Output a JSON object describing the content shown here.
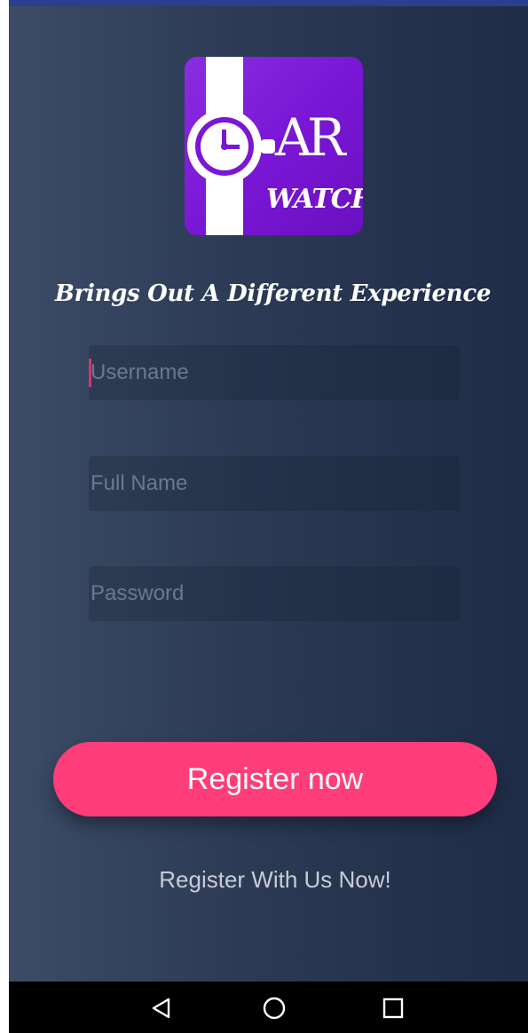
{
  "app": {
    "logo": {
      "text_ar": "AR",
      "text_watch": "WATCH",
      "icon": "watch-icon",
      "colors": {
        "background": "#7a17d6",
        "foreground": "#ffffff"
      }
    },
    "tagline": "Brings Out A Different Experience"
  },
  "form": {
    "username": {
      "placeholder": "Username",
      "value": ""
    },
    "fullname": {
      "placeholder": "Full Name",
      "value": ""
    },
    "password": {
      "placeholder": "Password",
      "value": ""
    }
  },
  "actions": {
    "register_button": "Register now",
    "register_link": "Register With Us Now!"
  },
  "navigation": {
    "back_icon": "back-triangle-icon",
    "home_icon": "home-circle-icon",
    "recents_icon": "recents-square-icon"
  },
  "colors": {
    "accent": "#ff3d7a",
    "background_light": "#3c4c66",
    "background_dark": "#1f2c47",
    "cursor": "#d5356f"
  }
}
